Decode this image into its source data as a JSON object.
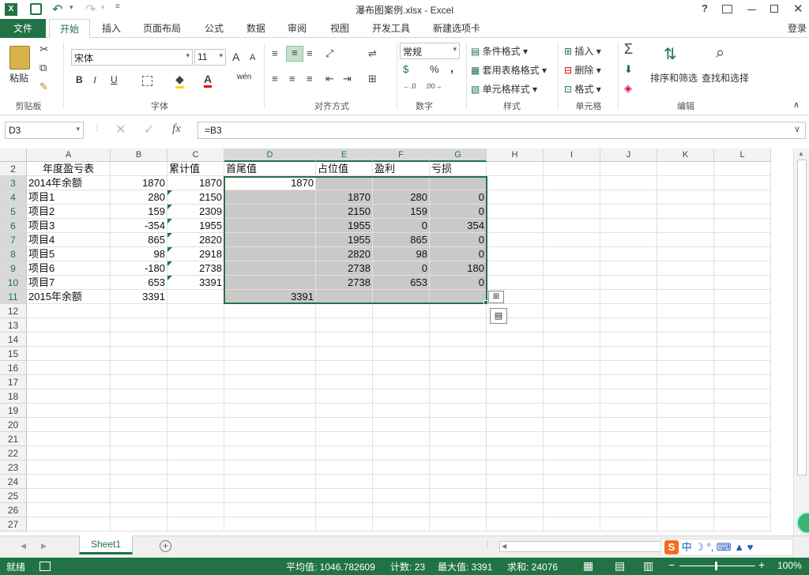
{
  "window": {
    "title": "瀑布图案例.xlsx - Excel",
    "help": "?",
    "login": "登录"
  },
  "tabs": [
    "文件",
    "开始",
    "插入",
    "页面布局",
    "公式",
    "数据",
    "审阅",
    "视图",
    "开发工具",
    "新建选项卡"
  ],
  "ribbon": {
    "clipboard": {
      "paste": "粘贴",
      "label": "剪贴板"
    },
    "font": {
      "name": "宋体",
      "size": "11",
      "grow": "A",
      "shrink": "A",
      "bold": "B",
      "italic": "I",
      "underline": "U",
      "phonetic": "wén",
      "label": "字体"
    },
    "align": {
      "label": "对齐方式"
    },
    "number": {
      "format": "常规",
      "percent": "%",
      "comma": ",",
      "label": "数字"
    },
    "styles": {
      "cond": "条件格式",
      "table": "套用表格格式",
      "cell": "单元格样式",
      "label": "样式"
    },
    "cells": {
      "insert": "插入",
      "delete": "删除",
      "format": "格式",
      "label": "单元格"
    },
    "editing": {
      "sort": "排序和筛选",
      "find": "查找和选择",
      "label": "编辑"
    }
  },
  "formula": {
    "namebox": "D3",
    "fx": "fx",
    "content": "=B3"
  },
  "columns": [
    "A",
    "B",
    "C",
    "D",
    "E",
    "F",
    "G",
    "H",
    "I",
    "J",
    "K",
    "L"
  ],
  "rows": [
    "2",
    "3",
    "4",
    "5",
    "6",
    "7",
    "8",
    "9",
    "10",
    "11",
    "12",
    "13",
    "14",
    "15",
    "16",
    "17",
    "18",
    "19",
    "20",
    "21",
    "22",
    "23",
    "24",
    "25",
    "26",
    "27"
  ],
  "cells": {
    "A2": "年度盈亏表",
    "C2": "累计值",
    "D2": "首尾值",
    "E2": "占位值",
    "F2": "盈利",
    "G2": "亏损",
    "A3": "2014年余额",
    "B3": "1870",
    "C3": "1870",
    "D3": "1870",
    "A4": "项目1",
    "B4": "280",
    "C4": "2150",
    "E4": "1870",
    "F4": "280",
    "G4": "0",
    "A5": "项目2",
    "B5": "159",
    "C5": "2309",
    "E5": "2150",
    "F5": "159",
    "G5": "0",
    "A6": "项目3",
    "B6": "-354",
    "C6": "1955",
    "E6": "1955",
    "F6": "0",
    "G6": "354",
    "A7": "项目4",
    "B7": "865",
    "C7": "2820",
    "E7": "1955",
    "F7": "865",
    "G7": "0",
    "A8": "项目5",
    "B8": "98",
    "C8": "2918",
    "E8": "2820",
    "F8": "98",
    "G8": "0",
    "A9": "项目6",
    "B9": "-180",
    "C9": "2738",
    "E9": "2738",
    "F9": "0",
    "G9": "180",
    "A10": "项目7",
    "B10": "653",
    "C10": "3391",
    "E10": "2738",
    "F10": "653",
    "G10": "0",
    "A11": "2015年余额",
    "B11": "3391",
    "D11": "3391"
  },
  "sheet": {
    "name": "Sheet1"
  },
  "status": {
    "ready": "就绪",
    "avg": "平均值: 1046.782609",
    "count": "计数: 23",
    "max": "最大值: 3391",
    "sum": "求和: 24076",
    "zoom": "100%"
  },
  "colors": {
    "excel_green": "#217346",
    "selection_shade": "#c9c9c9"
  }
}
